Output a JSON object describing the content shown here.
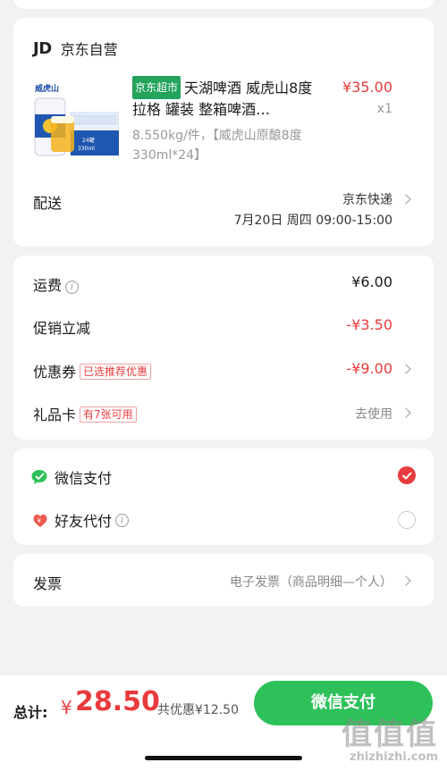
{
  "shop": {
    "logo": "JD",
    "name": "京东自营"
  },
  "product": {
    "tag": "京东超市",
    "title": "天湖啤酒 威虎山8度拉格 罐装 整箱啤酒…",
    "spec": "8.550kg/件，【威虎山原酿8度 330ml*24】",
    "price": "¥35.00",
    "qty": "x1"
  },
  "shipping": {
    "label": "配送",
    "method": "京东快递",
    "time": "7月20日 周四 09:00-15:00"
  },
  "fees": {
    "freight_label": "运费",
    "freight_value": "¥6.00",
    "promo_label": "促销立减",
    "promo_value": "-¥3.50",
    "coupon_label": "优惠券",
    "coupon_badge": "已选推荐优惠",
    "coupon_value": "-¥9.00",
    "giftcard_label": "礼品卡",
    "giftcard_badge": "有7张可用",
    "giftcard_value": "去使用"
  },
  "payment": {
    "wechat_label": "微信支付",
    "friend_label": "好友代付",
    "selected": "wechat"
  },
  "invoice": {
    "label": "发票",
    "value": "电子发票（商品明细—个人）"
  },
  "bottom": {
    "total_label": "总计:",
    "currency": "¥",
    "total": "28.50",
    "discount": "共优惠¥12.50",
    "pay_button": "微信支付"
  },
  "watermark": {
    "big": "值值值",
    "small": "zhizhizhi.com"
  },
  "colors": {
    "accent_red": "#e93b3d",
    "wechat_green": "#2ec15a",
    "tag_green": "#23a35b"
  }
}
